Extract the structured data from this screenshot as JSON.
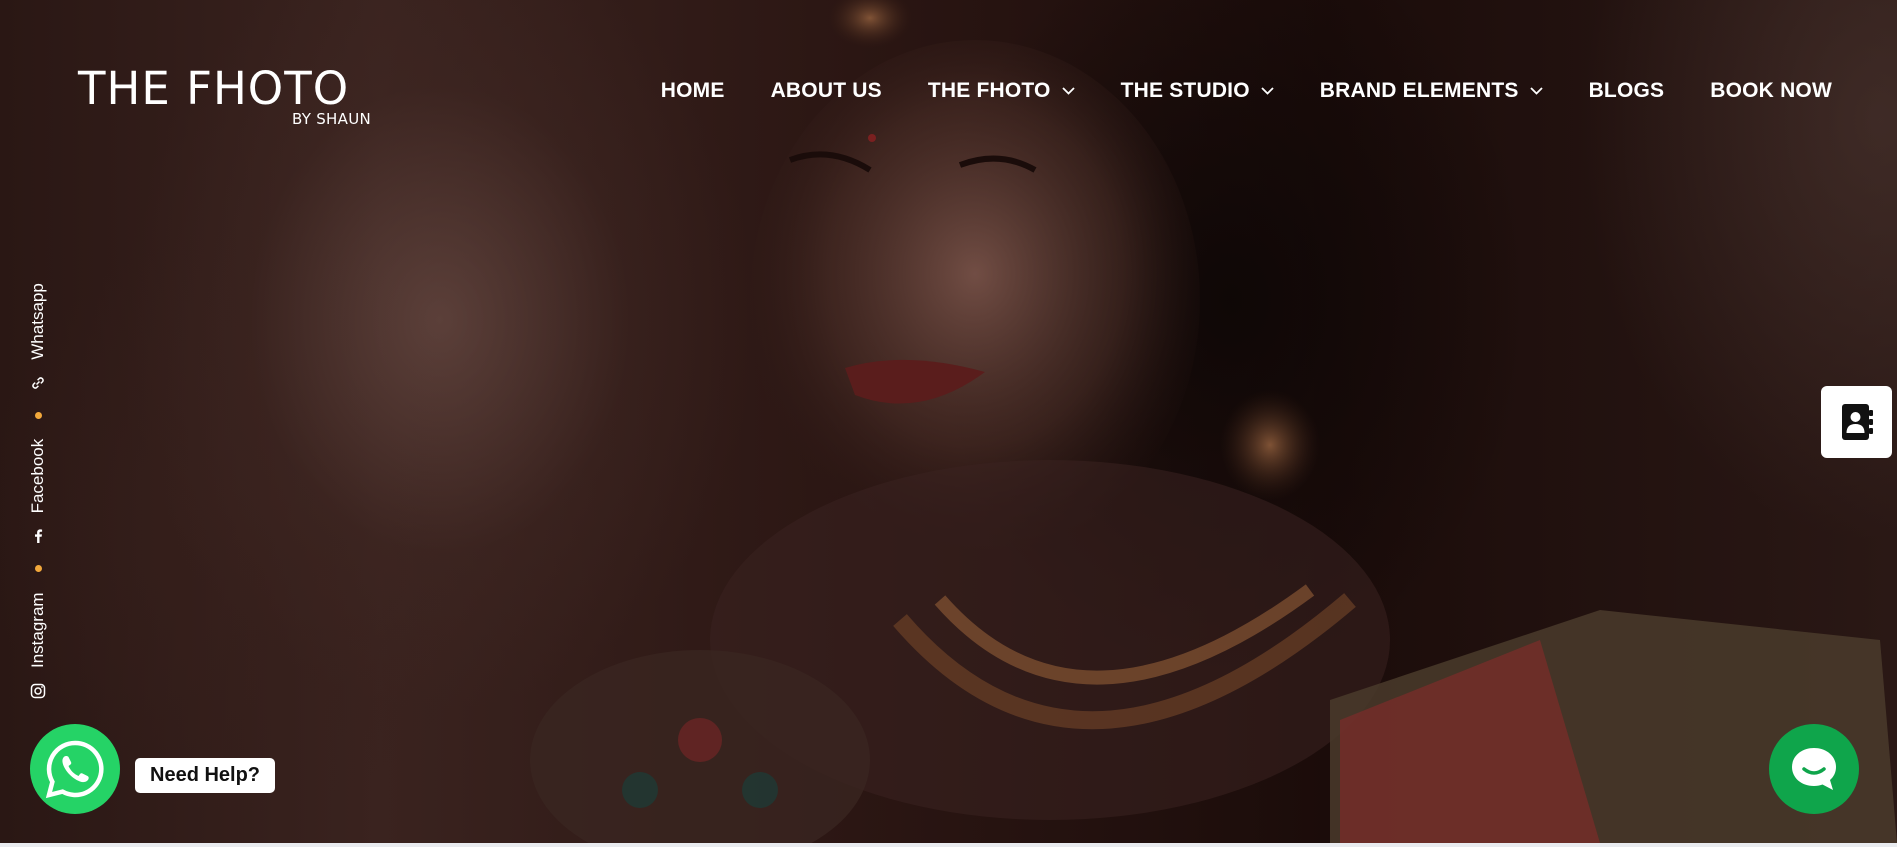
{
  "logo": {
    "title": "THE FHOTO",
    "subtitle": "BY SHAUN"
  },
  "nav": {
    "items": [
      {
        "label": "HOME",
        "dropdown": false
      },
      {
        "label": "ABOUT US",
        "dropdown": false
      },
      {
        "label": "THE FHOTO",
        "dropdown": true
      },
      {
        "label": "THE STUDIO",
        "dropdown": true
      },
      {
        "label": "BRAND ELEMENTS",
        "dropdown": true
      },
      {
        "label": "BLOGS",
        "dropdown": false
      },
      {
        "label": "BOOK NOW",
        "dropdown": false
      }
    ]
  },
  "social": {
    "items": [
      {
        "label": "Instagram",
        "icon": "instagram-icon"
      },
      {
        "label": "Facebook",
        "icon": "facebook-icon"
      },
      {
        "label": "Whatsapp",
        "icon": "link-icon"
      }
    ],
    "dot_color": "#f2a83b"
  },
  "help": {
    "label": "Need Help?"
  },
  "colors": {
    "whatsapp_green": "#25d366",
    "chat_green": "#0fa54b",
    "text": "#ffffff"
  }
}
